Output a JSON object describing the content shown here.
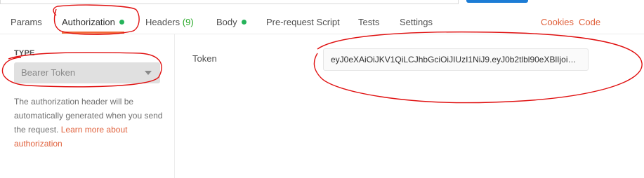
{
  "tabs": [
    {
      "label": "Params"
    },
    {
      "label": "Authorization"
    },
    {
      "label": "Headers",
      "count": "(9)"
    },
    {
      "label": "Body"
    },
    {
      "label": "Pre-request Script"
    },
    {
      "label": "Tests"
    },
    {
      "label": "Settings"
    }
  ],
  "right_links": {
    "cookies": "Cookies",
    "code": "Code"
  },
  "auth": {
    "type_label": "TYPE",
    "type_value": "Bearer Token",
    "description": "The authorization header will be automatically generated when you send the request.",
    "learn_more": "Learn more about authorization",
    "token_label": "Token",
    "token_value": "eyJ0eXAiOiJKV1QiLCJhbGciOiJIUzI1NiJ9.eyJ0b2tlbl90eXBlIjoiYWI..."
  },
  "colors": {
    "accent": "#f26b3a",
    "link": "#e0613c",
    "dot": "#26b35a",
    "annotation": "#e01010"
  }
}
